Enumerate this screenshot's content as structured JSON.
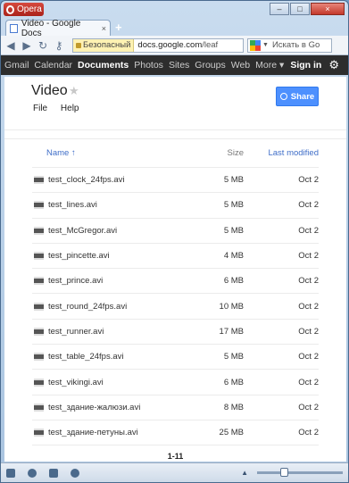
{
  "browser": {
    "menu_label": "Opera",
    "tab_title": "Video - Google Docs",
    "tab_close": "×",
    "new_tab": "+",
    "secure_label": "Безопасный",
    "url_host": "docs.google.com",
    "url_path": "/leaf",
    "search_placeholder": "Искать в Go",
    "window_controls": [
      "–",
      "□",
      "×"
    ]
  },
  "gbar": {
    "items": [
      "Gmail",
      "Calendar",
      "Documents",
      "Photos",
      "Sites",
      "Groups",
      "Web",
      "More ▾"
    ],
    "active": "Documents",
    "signin": "Sign in"
  },
  "doc": {
    "title": "Video",
    "menu": [
      "File",
      "Help"
    ],
    "share_label": "Share"
  },
  "list": {
    "headers": {
      "name": "Name ↑",
      "size": "Size",
      "modified": "Last modified"
    },
    "rows": [
      {
        "name": "test_clock_24fps.avi",
        "size": "5 MB",
        "modified": "Oct 2"
      },
      {
        "name": "test_lines.avi",
        "size": "5 MB",
        "modified": "Oct 2"
      },
      {
        "name": "test_McGregor.avi",
        "size": "5 MB",
        "modified": "Oct 2"
      },
      {
        "name": "test_pincette.avi",
        "size": "4 MB",
        "modified": "Oct 2"
      },
      {
        "name": "test_prince.avi",
        "size": "6 MB",
        "modified": "Oct 2"
      },
      {
        "name": "test_round_24fps.avi",
        "size": "10 MB",
        "modified": "Oct 2"
      },
      {
        "name": "test_runner.avi",
        "size": "17 MB",
        "modified": "Oct 2"
      },
      {
        "name": "test_table_24fps.avi",
        "size": "5 MB",
        "modified": "Oct 2"
      },
      {
        "name": "test_vikingi.avi",
        "size": "6 MB",
        "modified": "Oct 2"
      },
      {
        "name": "test_здание-жалюзи.avi",
        "size": "8 MB",
        "modified": "Oct 2"
      },
      {
        "name": "test_здание-петуны.avi",
        "size": "25 MB",
        "modified": "Oct 2"
      }
    ],
    "pager": "1-11"
  },
  "statusbar": {
    "zoom_fraction": 0.3
  }
}
